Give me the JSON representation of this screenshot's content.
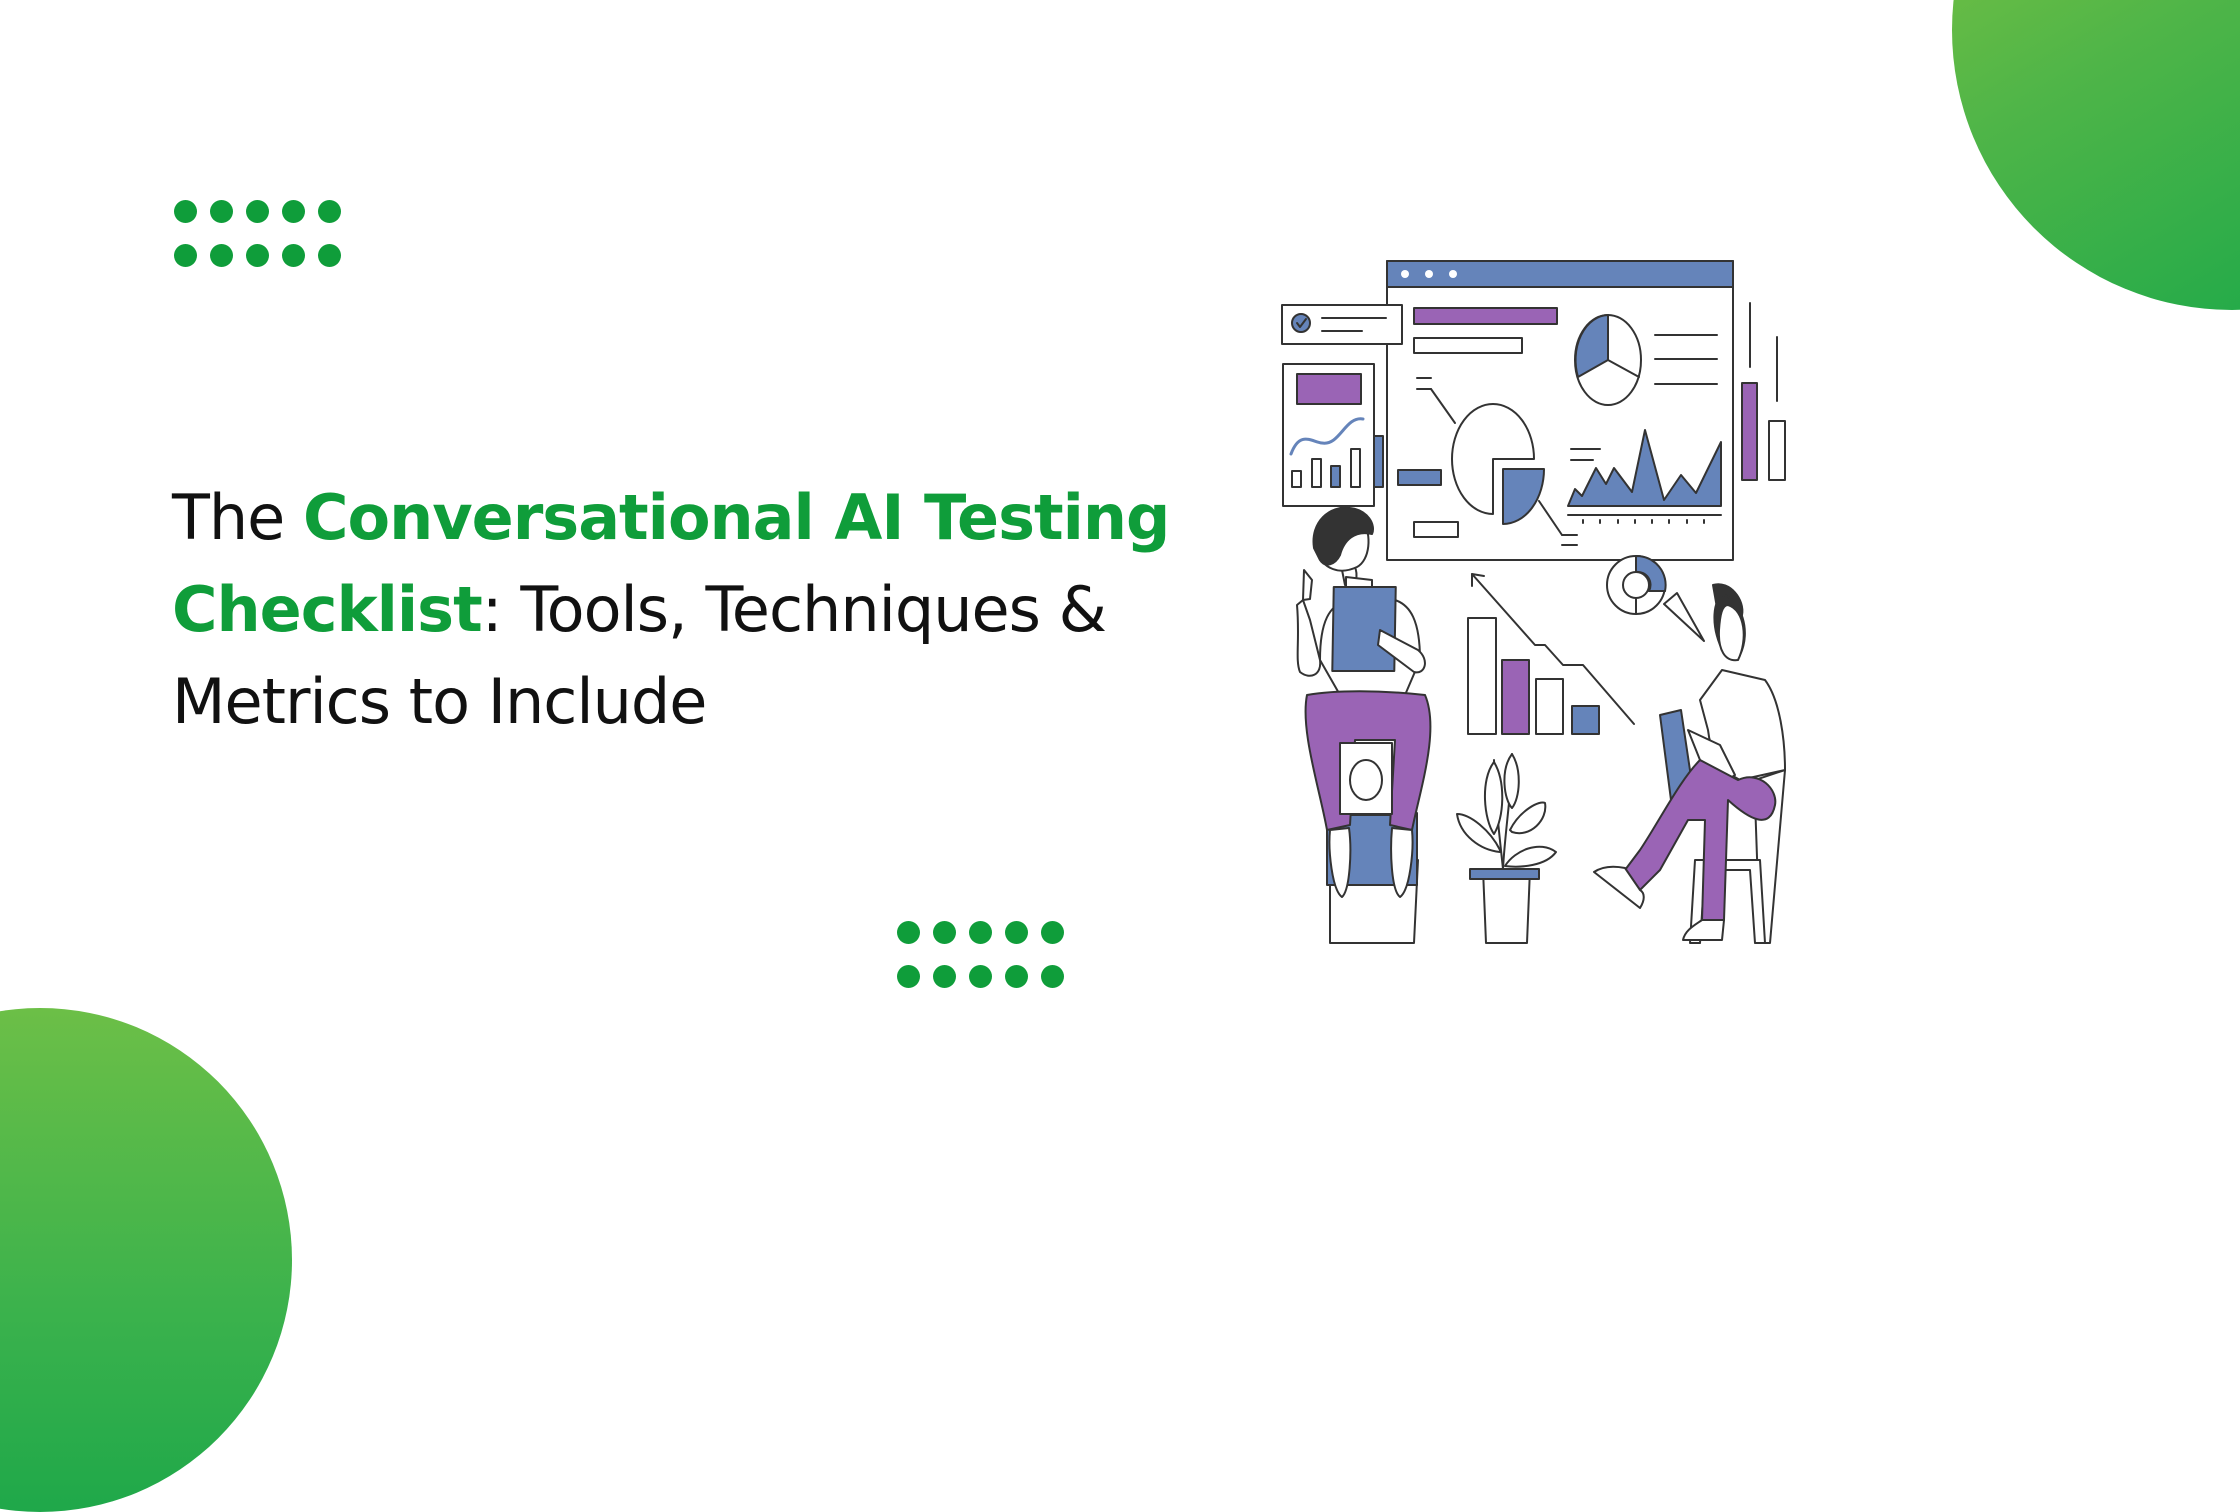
{
  "title": {
    "prefix": "The ",
    "highlight_1": "Conversational AI Testing",
    "line_break_highlight": "Checklist",
    "suffix_1": ": Tools, Techniques &",
    "suffix_2": "Metrics to Include"
  },
  "colors": {
    "accent_green": "#0f9d3a",
    "illustration_blue": "#6584ba",
    "illustration_purple": "#9a64b5",
    "outline": "#333333"
  },
  "illustration": {
    "subject": "two people reviewing analytics dashboard",
    "icons": [
      "browser-window-icon",
      "pie-chart-icon",
      "area-chart-icon",
      "bar-chart-icon",
      "donut-chart-icon",
      "checkmark-icon",
      "plant-icon",
      "trend-arrow-icon"
    ]
  }
}
